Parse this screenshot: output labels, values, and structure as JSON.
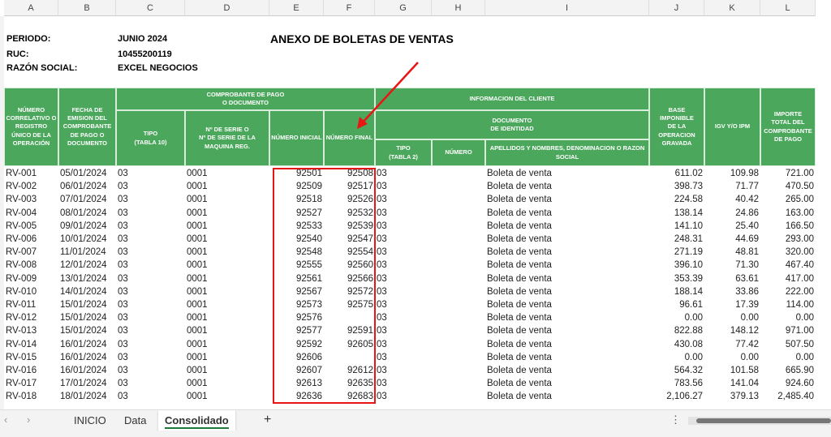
{
  "columns": [
    "A",
    "B",
    "C",
    "D",
    "E",
    "F",
    "G",
    "H",
    "I",
    "J",
    "K",
    "L"
  ],
  "info": {
    "periodo_label": "PERIODO:",
    "periodo_value": "JUNIO 2024",
    "ruc_label": "RUC:",
    "ruc_value": "10455200119",
    "razon_label": "RAZÓN SOCIAL:",
    "razon_value": "EXCEL NEGOCIOS",
    "title": "ANEXO DE BOLETAS DE VENTAS"
  },
  "header": {
    "correlativo": "NÚMERO\nCORRELATIVO O\nREGISTRO\nÚNICO DE LA\nOPERACIÓN",
    "fecha": "FECHA DE\nEMISION DEL\nCOMPROBANTE\nDE PAGO O\nDOCUMENTO",
    "comprobante": "COMPROBANTE DE PAGO\nO DOCUMENTO",
    "tipo": "TIPO\n(TABLA 10)",
    "serie": "Nº DE SERIE O\nNº DE SERIE DE LA\nMAQUINA REG.",
    "num_inicial": "NÚMERO INICIAL",
    "num_final": "NÚMERO FINAL",
    "cliente": "INFORMACION DEL CLIENTE",
    "documento": "DOCUMENTO\nDE IDENTIDAD",
    "doc_tipo": "TIPO\n(TABLA 2)",
    "doc_numero": "NÚMERO",
    "apellidos": "APELLIDOS Y NOMBRES, DENOMINACION O RAZON\nSOCIAL",
    "base": "BASE IMPONIBLE\nDE LA\nOPERACION\nGRAVADA",
    "igv": "IGV Y/O IPM",
    "importe": "IMPORTE\nTOTAL DEL\nCOMPROBANTE\nDE PAGO"
  },
  "rows": [
    [
      "RV-001",
      "05/01/2024",
      "03",
      "0001",
      "92501",
      "92508",
      "03",
      "",
      "Boleta de venta",
      "611.02",
      "109.98",
      "721.00"
    ],
    [
      "RV-002",
      "06/01/2024",
      "03",
      "0001",
      "92509",
      "92517",
      "03",
      "",
      "Boleta de venta",
      "398.73",
      "71.77",
      "470.50"
    ],
    [
      "RV-003",
      "07/01/2024",
      "03",
      "0001",
      "92518",
      "92526",
      "03",
      "",
      "Boleta de venta",
      "224.58",
      "40.42",
      "265.00"
    ],
    [
      "RV-004",
      "08/01/2024",
      "03",
      "0001",
      "92527",
      "92532",
      "03",
      "",
      "Boleta de venta",
      "138.14",
      "24.86",
      "163.00"
    ],
    [
      "RV-005",
      "09/01/2024",
      "03",
      "0001",
      "92533",
      "92539",
      "03",
      "",
      "Boleta de venta",
      "141.10",
      "25.40",
      "166.50"
    ],
    [
      "RV-006",
      "10/01/2024",
      "03",
      "0001",
      "92540",
      "92547",
      "03",
      "",
      "Boleta de venta",
      "248.31",
      "44.69",
      "293.00"
    ],
    [
      "RV-007",
      "11/01/2024",
      "03",
      "0001",
      "92548",
      "92554",
      "03",
      "",
      "Boleta de venta",
      "271.19",
      "48.81",
      "320.00"
    ],
    [
      "RV-008",
      "12/01/2024",
      "03",
      "0001",
      "92555",
      "92560",
      "03",
      "",
      "Boleta de venta",
      "396.10",
      "71.30",
      "467.40"
    ],
    [
      "RV-009",
      "13/01/2024",
      "03",
      "0001",
      "92561",
      "92566",
      "03",
      "",
      "Boleta de venta",
      "353.39",
      "63.61",
      "417.00"
    ],
    [
      "RV-010",
      "14/01/2024",
      "03",
      "0001",
      "92567",
      "92572",
      "03",
      "",
      "Boleta de venta",
      "188.14",
      "33.86",
      "222.00"
    ],
    [
      "RV-011",
      "15/01/2024",
      "03",
      "0001",
      "92573",
      "92575",
      "03",
      "",
      "Boleta de venta",
      "96.61",
      "17.39",
      "114.00"
    ],
    [
      "RV-012",
      "15/01/2024",
      "03",
      "0001",
      "92576",
      "",
      "03",
      "",
      "Boleta de venta",
      "0.00",
      "0.00",
      "0.00"
    ],
    [
      "RV-013",
      "15/01/2024",
      "03",
      "0001",
      "92577",
      "92591",
      "03",
      "",
      "Boleta de venta",
      "822.88",
      "148.12",
      "971.00"
    ],
    [
      "RV-014",
      "16/01/2024",
      "03",
      "0001",
      "92592",
      "92605",
      "03",
      "",
      "Boleta de venta",
      "430.08",
      "77.42",
      "507.50"
    ],
    [
      "RV-015",
      "16/01/2024",
      "03",
      "0001",
      "92606",
      "",
      "03",
      "",
      "Boleta de venta",
      "0.00",
      "0.00",
      "0.00"
    ],
    [
      "RV-016",
      "16/01/2024",
      "03",
      "0001",
      "92607",
      "92612",
      "03",
      "",
      "Boleta de venta",
      "564.32",
      "101.58",
      "665.90"
    ],
    [
      "RV-017",
      "17/01/2024",
      "03",
      "0001",
      "92613",
      "92635",
      "03",
      "",
      "Boleta de venta",
      "783.56",
      "141.04",
      "924.60"
    ],
    [
      "RV-018",
      "18/01/2024",
      "03",
      "0001",
      "92636",
      "92683",
      "03",
      "",
      "Boleta de venta",
      "2,106.27",
      "379.13",
      "2,485.40"
    ]
  ],
  "sheet_tabs": [
    "INICIO",
    "Data",
    "Consolidado"
  ],
  "active_tab": "Consolidado",
  "add_sheet": "+",
  "colors": {
    "header_green": "#4aa75b",
    "highlight_red": "#e81515",
    "active_tab_underline": "#1e7b34"
  }
}
